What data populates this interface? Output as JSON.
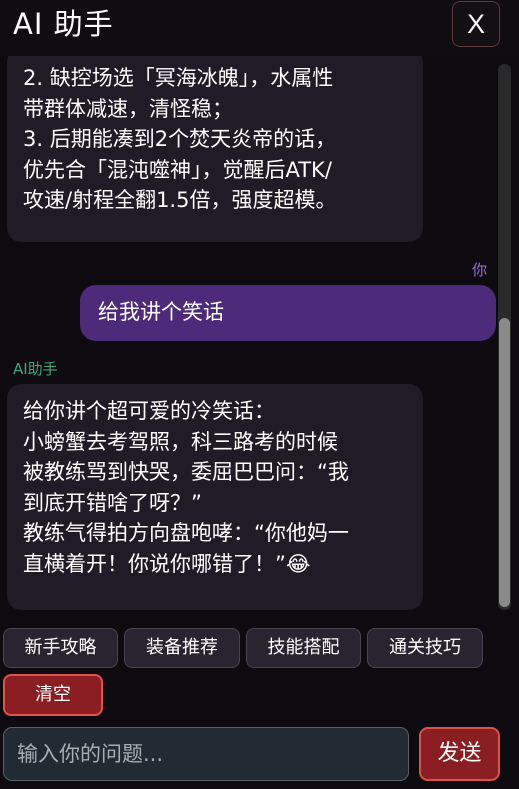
{
  "header": {
    "title": "AI 助手",
    "close_label": "X"
  },
  "messages": [
    {
      "sender": "ai",
      "lines": [
        "2. 缺控场选「冥海冰魄」，水属性",
        "带群体减速，清怪稳；",
        "3. 后期能凑到2个焚天炎帝的话，",
        "优先合「混沌噬神」，觉醒后ATK/",
        "攻速/射程全翻1.5倍，强度超模。"
      ]
    },
    {
      "sender": "user",
      "sender_label": "你",
      "lines": [
        "给我讲个笑话"
      ]
    },
    {
      "sender": "ai",
      "sender_label": "AI助手",
      "lines": [
        "给你讲个超可爱的冷笑话：",
        "小螃蟹去考驾照，科三路考的时候",
        "被教练骂到快哭，委屈巴巴问：“我",
        "到底开错啥了呀？”",
        "教练气得拍方向盘咆哮：“你他妈一",
        "直横着开！你说你哪错了！”😂"
      ]
    }
  ],
  "quick_actions": [
    "新手攻略",
    "装备推荐",
    "技能搭配",
    "通关技巧"
  ],
  "clear_label": "清空",
  "input": {
    "placeholder": "输入你的问题..."
  },
  "send_label": "发送",
  "colors": {
    "background": "#0d0b10",
    "ai_bubble": "#201b26",
    "user_bubble": "#4e2a7a",
    "user_label": "#9b73d6",
    "ai_label": "#3fa67a",
    "danger": "#8a1e22"
  }
}
